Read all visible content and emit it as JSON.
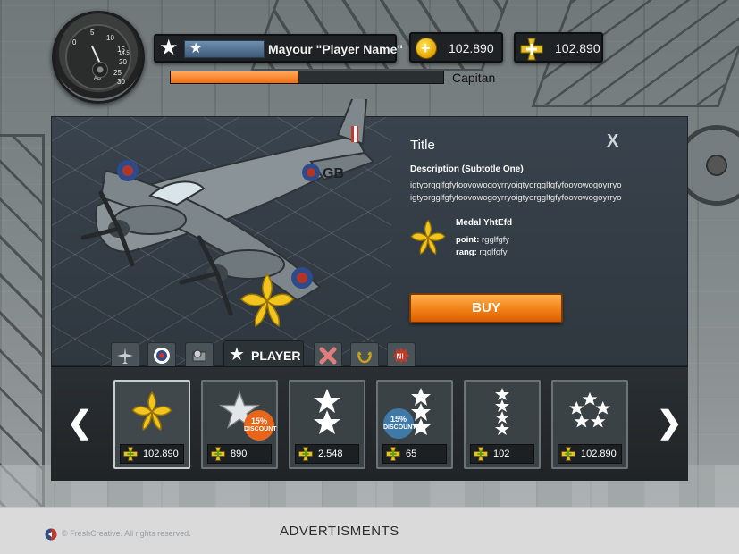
{
  "hud": {
    "gauge": {
      "labels": [
        "5",
        "10",
        "15",
        "0",
        "20",
        "25",
        "30",
        "14.5",
        "AB"
      ]
    },
    "rank_name": "Mayour \"Player Name\"",
    "currency_gold": "102.890",
    "currency_medals": "102.890",
    "xp_progress": 0.47,
    "rank_title": "Capitan"
  },
  "detail": {
    "title": "Title",
    "close_label": "X",
    "description_title": "Description (Subtotle One)",
    "description_line1": "igtyorgglfgfyfoovowogoyrryoigtyorgglfgfyfoovowogoyrryo",
    "description_line2": "igtyorgglfgfyfoovowogoyrryoigtyorgglfgfyfoovowogoyrryo",
    "medal_name": "Medal YhtEfd",
    "point_label": "point:",
    "point_value": "rgglfgfy",
    "rang_label": "rang:",
    "rang_value": "rgglfgfy",
    "buy_label": "BUY"
  },
  "plane": {
    "tail_code": "GB"
  },
  "tabs": {
    "icons": [
      "plane-icon",
      "roundel-icon",
      "gear-box-icon",
      "star-icon",
      "cross-icon",
      "wreath-icon",
      "new-badge-icon"
    ],
    "active_label": "PLAYER",
    "new_badge_text": "N!"
  },
  "shop": {
    "prev_label": "❮",
    "next_label": "❯",
    "items": [
      {
        "name": "gold-oak-leaf",
        "price": "102.890"
      },
      {
        "name": "silver-star-discount",
        "price": "890",
        "discount": "15%",
        "discount_label": "DISCOUNT"
      },
      {
        "name": "two-stars",
        "price": "2.548"
      },
      {
        "name": "three-stars-discount",
        "price": "65",
        "discount": "15%",
        "discount_label": "DISCOUNT"
      },
      {
        "name": "four-stars",
        "price": "102"
      },
      {
        "name": "five-stars-circle",
        "price": "102.890"
      }
    ]
  },
  "footer": {
    "copyright": "© FreshCreative. All rights reserved.",
    "ads": "ADVERTISMENTS"
  },
  "colors": {
    "accent_orange": "#f07c12",
    "panel_bg": "#323b44",
    "medal_gold": "#f2c41e"
  }
}
